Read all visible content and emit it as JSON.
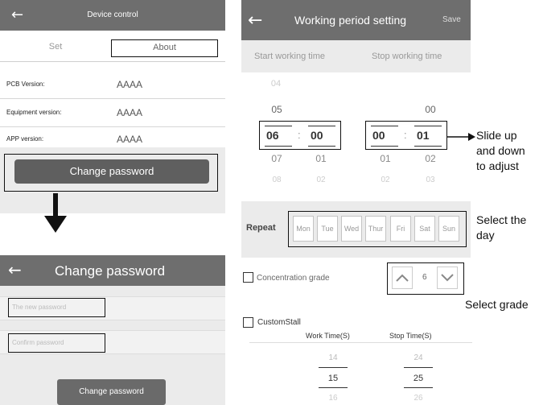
{
  "device_control": {
    "title": "Device control",
    "tabs": [
      {
        "label": "Set",
        "active": false
      },
      {
        "label": "About",
        "active": true
      }
    ],
    "rows": [
      {
        "label": "PCB Version:",
        "value": "AAAA"
      },
      {
        "label": "Equipment version:",
        "value": "AAAA"
      },
      {
        "label": "APP version:",
        "value": "AAAA"
      }
    ],
    "change_password_button": "Change password"
  },
  "change_password": {
    "title": "Change password",
    "new_password_placeholder": "The new password",
    "confirm_password_placeholder": "Confirm password",
    "submit_button": "Change password"
  },
  "working_period": {
    "title": "Working period setting",
    "save_label": "Save",
    "start_label": "Start working time",
    "stop_label": "Stop working time",
    "start_hours": [
      "04",
      "05",
      "06",
      "07",
      "08"
    ],
    "start_minutes": [
      "00",
      "01",
      "02"
    ],
    "stop_hours": [
      "00",
      "01",
      "02"
    ],
    "stop_minutes": [
      "00",
      "01",
      "02",
      "03"
    ],
    "separator": ":",
    "repeat_label": "Repeat",
    "days": [
      "Mon",
      "Tue",
      "Wed",
      "Thur",
      "Fri",
      "Sat",
      "Sun"
    ],
    "concentration_label": "Concentration grade",
    "grade_value": "6",
    "custom_stall_label": "CustomStall",
    "work_time_header": "Work Time(S)",
    "stop_time_header": "Stop Time(S)",
    "work_times": [
      "14",
      "15",
      "16"
    ],
    "stop_times": [
      "24",
      "25",
      "26"
    ]
  },
  "annotations": {
    "slide": [
      "Slide up",
      "and down",
      "to adjust"
    ],
    "select_day": [
      "Select the",
      "day"
    ],
    "select_grade": "Select grade"
  }
}
